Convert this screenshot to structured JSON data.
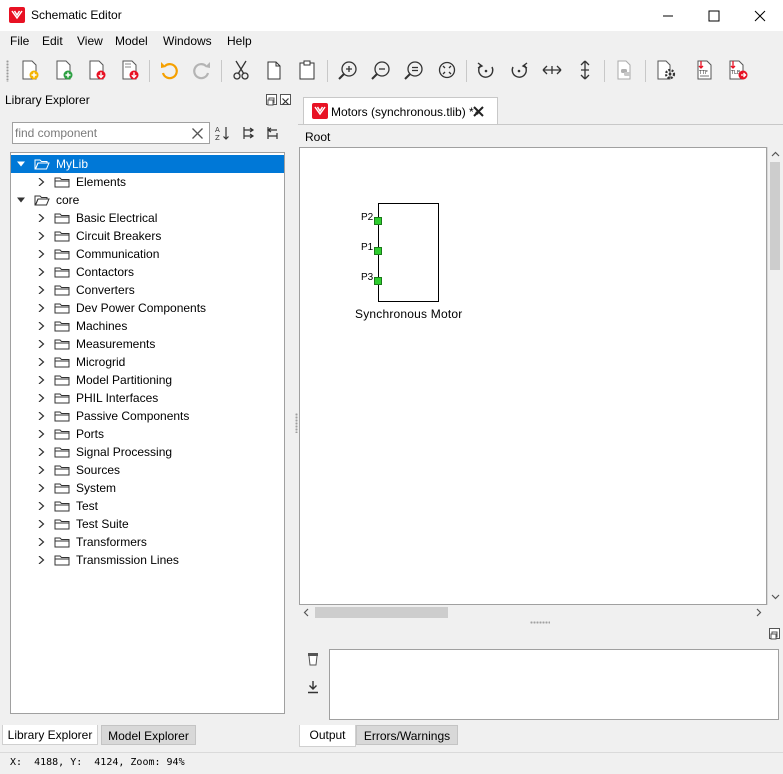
{
  "window": {
    "title": "Schematic Editor",
    "accent": "#e81123"
  },
  "menu": [
    "File",
    "Edit",
    "View",
    "Model",
    "Windows",
    "Help"
  ],
  "toolbar": {
    "icons": [
      "new-file-icon",
      "new-library-icon",
      "save-icon",
      "save-as-icon",
      "undo-icon",
      "redo-icon",
      "cut-icon",
      "copy-icon",
      "paste-icon",
      "zoom-in-icon",
      "zoom-out-icon",
      "zoom-fit-icon",
      "zoom-extents-icon",
      "rotate-left-icon",
      "rotate-right-icon",
      "flip-horizontal-icon",
      "flip-vertical-icon",
      "python-script-icon",
      "model-settings-icon",
      "export-ttf-icon",
      "compile-icon"
    ],
    "export_ttf_label": "TTF",
    "compile_label": "TLB"
  },
  "library_explorer": {
    "title": "Library Explorer",
    "search_placeholder": "find component",
    "tree": [
      {
        "label": "MyLib",
        "level": 0,
        "expanded": true,
        "selected": true
      },
      {
        "label": "Elements",
        "level": 1,
        "expanded": false
      },
      {
        "label": "core",
        "level": 0,
        "expanded": true
      },
      {
        "label": "Basic Electrical",
        "level": 1,
        "expanded": false
      },
      {
        "label": "Circuit Breakers",
        "level": 1,
        "expanded": false
      },
      {
        "label": "Communication",
        "level": 1,
        "expanded": false
      },
      {
        "label": "Contactors",
        "level": 1,
        "expanded": false
      },
      {
        "label": "Converters",
        "level": 1,
        "expanded": false
      },
      {
        "label": "Dev Power Components",
        "level": 1,
        "expanded": false
      },
      {
        "label": "Machines",
        "level": 1,
        "expanded": false
      },
      {
        "label": "Measurements",
        "level": 1,
        "expanded": false
      },
      {
        "label": "Microgrid",
        "level": 1,
        "expanded": false
      },
      {
        "label": "Model Partitioning",
        "level": 1,
        "expanded": false
      },
      {
        "label": "PHIL Interfaces",
        "level": 1,
        "expanded": false
      },
      {
        "label": "Passive Components",
        "level": 1,
        "expanded": false
      },
      {
        "label": "Ports",
        "level": 1,
        "expanded": false
      },
      {
        "label": "Signal Processing",
        "level": 1,
        "expanded": false
      },
      {
        "label": "Sources",
        "level": 1,
        "expanded": false
      },
      {
        "label": "System",
        "level": 1,
        "expanded": false
      },
      {
        "label": "Test",
        "level": 1,
        "expanded": false
      },
      {
        "label": "Test Suite",
        "level": 1,
        "expanded": false
      },
      {
        "label": "Transformers",
        "level": 1,
        "expanded": false
      },
      {
        "label": "Transmission Lines",
        "level": 1,
        "expanded": false
      }
    ],
    "tabs": [
      "Library Explorer",
      "Model Explorer"
    ]
  },
  "document": {
    "tab_label": "Motors (synchronous.tlib) *",
    "breadcrumb": "Root",
    "component": {
      "name": "Synchronous Motor",
      "ports": [
        "P2",
        "P1",
        "P3"
      ],
      "port_color": "#2ecc2e"
    }
  },
  "output": {
    "tabs": [
      "Output",
      "Errors/Warnings"
    ]
  },
  "status": {
    "text": "X:  4188, Y:  4124, Zoom: 94%"
  }
}
